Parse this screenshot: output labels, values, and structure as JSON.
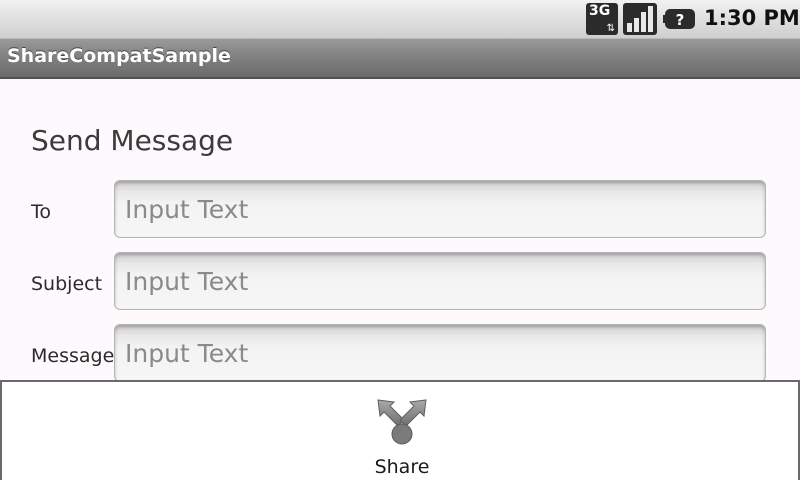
{
  "status_bar": {
    "network_label": "3G",
    "time": "1:30 PM",
    "icons": [
      "network-3g-icon",
      "signal-strength-icon",
      "battery-unknown-icon"
    ]
  },
  "app": {
    "title": "ShareCompatSample"
  },
  "form": {
    "heading": "Send Message",
    "fields": [
      {
        "label": "To",
        "value": "",
        "placeholder": "Input Text"
      },
      {
        "label": "Subject",
        "value": "",
        "placeholder": "Input Text"
      },
      {
        "label": "Message",
        "value": "",
        "placeholder": "Input Text"
      }
    ]
  },
  "action_bar": {
    "share_label": "Share",
    "share_icon": "share-icon"
  },
  "colors": {
    "background": "#fdf9fd",
    "title_bar": "#7f7f7f",
    "status_bar": "#dcdcdc"
  }
}
